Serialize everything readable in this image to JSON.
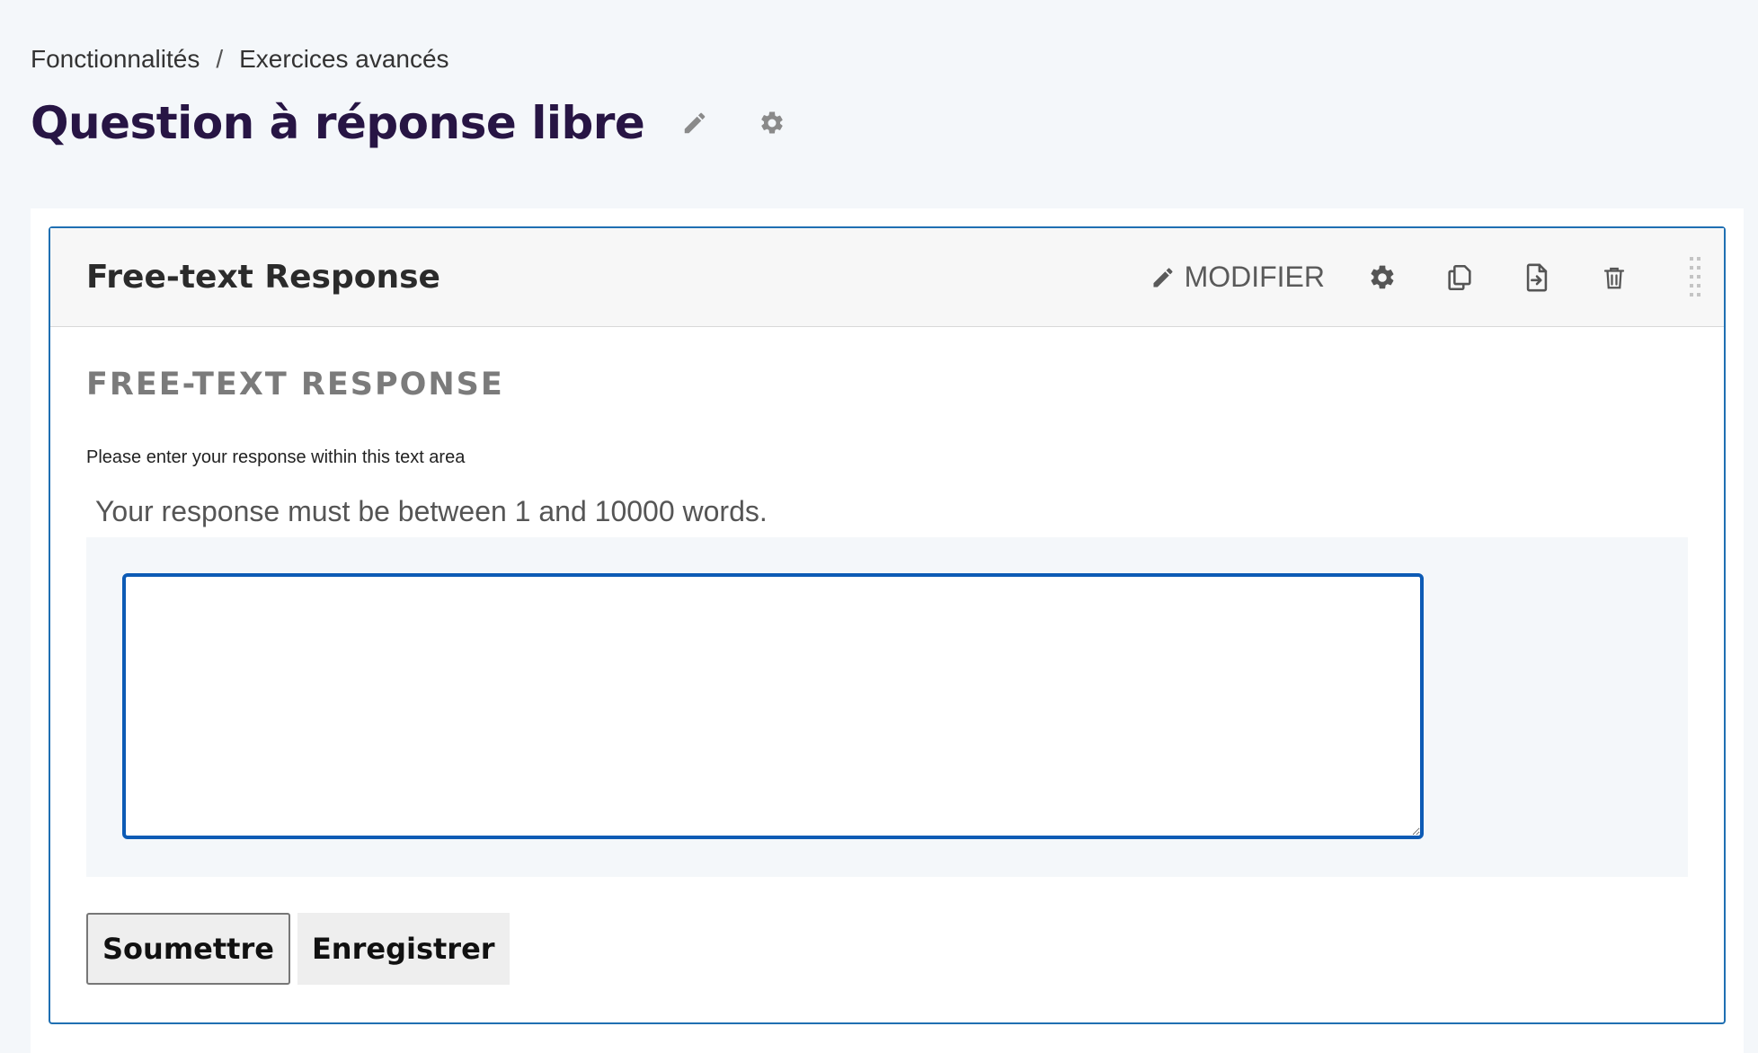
{
  "breadcrumb": {
    "items": [
      "Fonctionnalités",
      "Exercices avancés"
    ],
    "separator": "/"
  },
  "page": {
    "title": "Question à réponse libre",
    "title_icons": [
      "pencil-icon",
      "gear-icon"
    ]
  },
  "block": {
    "title": "Free-text Response",
    "modify_label": "MODIFIER",
    "action_icons": [
      "pencil-icon",
      "gear-icon",
      "duplicate-icon",
      "move-icon",
      "trash-icon",
      "drag-handle-icon"
    ]
  },
  "problem": {
    "heading": "FREE-TEXT RESPONSE",
    "prompt": "Please enter your response within this text area",
    "limit_text": "Your response must be between 1 and 10000 words.",
    "answer_value": ""
  },
  "actions": {
    "submit_label": "Soumettre",
    "save_label": "Enregistrer"
  },
  "colors": {
    "title": "#271544",
    "accent_border": "#1f6fb2",
    "textarea_focus": "#0d5bb5",
    "background": "#f4f7fa"
  }
}
